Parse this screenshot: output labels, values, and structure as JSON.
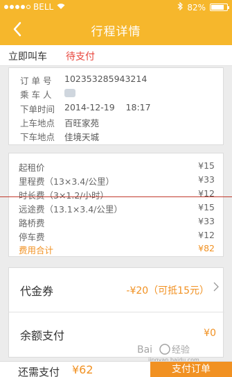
{
  "status_bar": {
    "carrier": "BELL",
    "battery": "82%",
    "battery_level": 0.82
  },
  "header": {
    "title": "行程详情"
  },
  "order": {
    "type": "立即叫车",
    "status": "待支付"
  },
  "info": [
    {
      "key": "订 单 号",
      "value": "102353285943214"
    },
    {
      "key": "乘 车 人",
      "value": ""
    },
    {
      "key": "下单时间",
      "value": "2014-12-19    18:17"
    },
    {
      "key": "上车地点",
      "value": "百旺家苑"
    },
    {
      "key": "下车地点",
      "value": "佳境天城"
    }
  ],
  "fees": [
    {
      "name": "起租价",
      "amount": "¥15"
    },
    {
      "name": "里程费（13×3.4/公里）",
      "amount": "¥33"
    },
    {
      "name": "时长费（3×1.2/小时）",
      "amount": "¥12"
    },
    {
      "name": "远途费（13.1×3.4/公里）",
      "amount": "¥15"
    },
    {
      "name": "路桥费",
      "amount": "¥33"
    },
    {
      "name": "停车费",
      "amount": "¥12"
    }
  ],
  "fee_total": {
    "name": "费用合计",
    "amount": "¥82"
  },
  "voucher": {
    "label": "代金券",
    "value": "-¥20（可抵15元）"
  },
  "balance": {
    "label": "余额支付",
    "value": "¥0"
  },
  "bottom": {
    "label": "还需支付",
    "amount": "¥62",
    "button": "支付订单"
  },
  "colors": {
    "header": "#f6b72c",
    "accent": "#f19122",
    "status_red": "#e8453c"
  }
}
